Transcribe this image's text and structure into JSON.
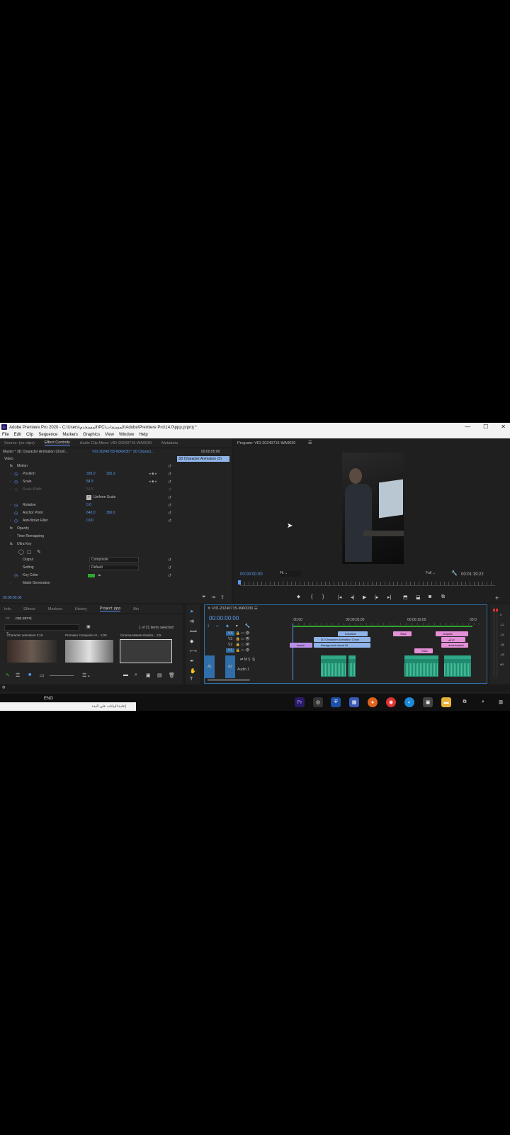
{
  "window": {
    "title": "Adobe Premiere Pro 2020 - C:\\Users\\المستخدم\\PC\\المستندات\\Adobe\\Premiere Pro\\14.0\\ppp.prproj *",
    "app_icon": "Pr",
    "controls": [
      "—",
      "☐",
      "✕"
    ]
  },
  "menu": [
    "File",
    "Edit",
    "Clip",
    "Sequence",
    "Markers",
    "Graphics",
    "View",
    "Window",
    "Help"
  ],
  "effect_panel": {
    "tabs": [
      "Source: (no clips)",
      "Effect Controls",
      "Audio Clip Mixer: VID-20240715-WA0030",
      "Metadata"
    ],
    "master_label": "Master * 3D Character Animation Chom...",
    "sequence_label": "VID-20240715-WA0030 * 3D Charact...",
    "time_top": "00:00:05:00",
    "clip_bar": "3D Character Animation Ch",
    "section_video": "Video",
    "rows": [
      {
        "label": "Motion",
        "v1": "",
        "v2": ""
      },
      {
        "label": "Position",
        "v1": "336.0",
        "v2": "325.3"
      },
      {
        "label": "Scale",
        "v1": "84.5",
        "v2": ""
      },
      {
        "label": "Scale Width",
        "v1": "54.5",
        "v2": ""
      },
      {
        "label": "Uniform Scale",
        "v1": "",
        "v2": ""
      },
      {
        "label": "Rotation",
        "v1": "0.0",
        "v2": ""
      },
      {
        "label": "Anchor Point",
        "v1": "640.0",
        "v2": "360.0"
      },
      {
        "label": "Anti-flicker Filter",
        "v1": "0.00",
        "v2": ""
      },
      {
        "label": "Opacity",
        "v1": "",
        "v2": ""
      },
      {
        "label": "Time Remapping",
        "v1": "",
        "v2": ""
      },
      {
        "label": "Ultra Key",
        "v1": "",
        "v2": ""
      },
      {
        "label": "Output",
        "v1": "Composite",
        "v2": ""
      },
      {
        "label": "Setting",
        "v1": "Default",
        "v2": ""
      },
      {
        "label": "Key Color",
        "v1": "",
        "v2": ""
      },
      {
        "label": "Matte Generation",
        "v1": "",
        "v2": ""
      }
    ],
    "timecode": "00:00:00:00",
    "fx": "fx"
  },
  "program": {
    "title": "Program: VID-20240715-WA0030",
    "timecode": "00:00:00:00",
    "fit": "Fit",
    "quality": "Full",
    "duration": "00:01:19:22"
  },
  "project": {
    "tabs": [
      "Info",
      "Effects",
      "Markers",
      "History",
      "Project: ppp",
      "Bin"
    ],
    "file": "ppp.prproj",
    "selection": "1 of 21 items selected",
    "thumbs": [
      {
        "name": "Character animation",
        "dur": "2;15"
      },
      {
        "name": "Premiere Composer H...",
        "dur": "1;00"
      },
      {
        "name": "Cinema-Master-Deskto...",
        "dur": "2;5"
      }
    ],
    "colors": {
      "key": "#2fa82f",
      "accent": "#5a9cf0"
    }
  },
  "timeline": {
    "title": "VID-20240715-WA0030",
    "timecode": "00:00:00:00",
    "ruler": [
      ":00:00",
      "00:00:05:00",
      "00:00:10:00",
      "00:0"
    ],
    "tracks": [
      "V4",
      "V3",
      "V2",
      "V1",
      "A1",
      "A2"
    ],
    "audio_label": "Audio 1",
    "clips": [
      {
        "label": "transition",
        "color": "blue2"
      },
      {
        "label": "Stick",
        "color": "pink"
      },
      {
        "label": "Graphic",
        "color": "pink"
      },
      {
        "label": "3D Character Animation Chom",
        "color": "blue2"
      },
      {
        "label": "جدكم",
        "color": "pink"
      },
      {
        "label": "downl",
        "color": "purple"
      },
      {
        "label": "Background visual 3d",
        "color": "blue2"
      },
      {
        "label": "downloaded",
        "color": "pink"
      },
      {
        "label": "Stick",
        "color": "pink"
      }
    ],
    "meter": [
      "0",
      "-12",
      "-24",
      "-36",
      "-48",
      "dB"
    ]
  },
  "taskbar": {
    "lang": "ENG",
    "notif": "إعادة البيانات على البدء"
  }
}
